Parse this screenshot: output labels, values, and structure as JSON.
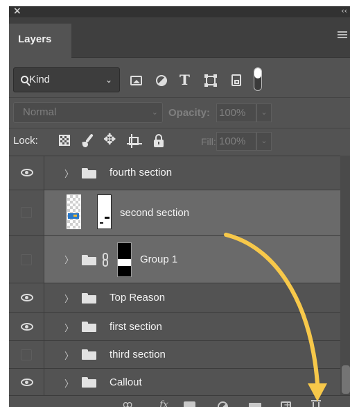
{
  "window": {
    "close_glyph": "×",
    "collapse_glyph": "‹‹"
  },
  "tabs": [
    {
      "label": "Layers",
      "active": true
    }
  ],
  "filter": {
    "kind_label": "Kind",
    "icons": [
      "image-filter-icon",
      "adjustment-filter-icon",
      "type-filter-icon",
      "shape-filter-icon",
      "smart-object-filter-icon",
      "filter-toggle"
    ],
    "type_glyph": "T"
  },
  "blending": {
    "mode": "Normal",
    "opacity_label": "Opacity:",
    "opacity_value": "100%"
  },
  "lock": {
    "label": "Lock:",
    "fill_label": "Fill:",
    "fill_value": "100%",
    "move_glyph": "✥"
  },
  "layers": [
    {
      "name": "fourth section",
      "visible": true,
      "type": "group",
      "selected": false
    },
    {
      "name": "second section",
      "visible": false,
      "type": "layer-with-mask",
      "selected": true
    },
    {
      "name": "Group 1",
      "visible": false,
      "type": "group-with-mask",
      "selected": true
    },
    {
      "name": "Top Reason",
      "visible": true,
      "type": "group",
      "selected": false
    },
    {
      "name": "first section",
      "visible": true,
      "type": "group",
      "selected": false
    },
    {
      "name": "third section",
      "visible": false,
      "type": "group",
      "selected": false
    },
    {
      "name": "Callout",
      "visible": true,
      "type": "group",
      "selected": false
    }
  ],
  "caret_glyph": "〉",
  "footer": {
    "link_glyph": "ꝏ",
    "fx_label": "fx"
  },
  "annotation": {
    "arrow_color": "#f7c84a"
  }
}
